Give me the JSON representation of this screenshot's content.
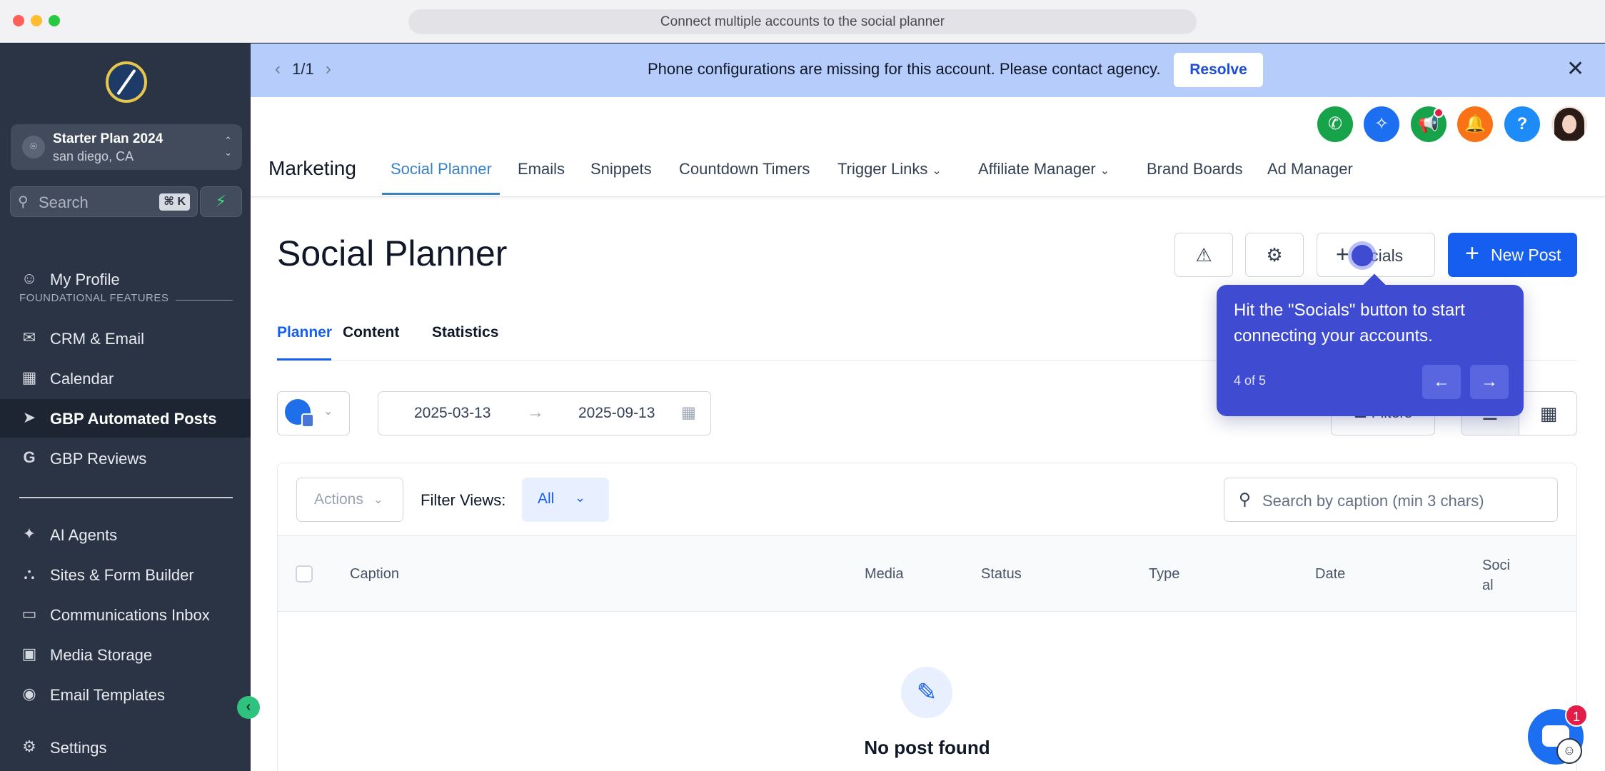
{
  "window": {
    "title": "Connect multiple accounts to the social planner"
  },
  "sidebar": {
    "account": {
      "name": "Starter Plan 2024",
      "location": "san diego, CA"
    },
    "search": {
      "placeholder": "Search",
      "shortcut": "⌘ K"
    },
    "items": [
      {
        "label": "My Profile",
        "icon": "user-circle-icon"
      },
      {
        "label": "CRM & Email",
        "icon": "envelope-open-icon"
      },
      {
        "label": "Calendar",
        "icon": "calendar-icon"
      },
      {
        "label": "GBP Automated Posts",
        "icon": "navigation-arrow-icon",
        "active": true
      },
      {
        "label": "GBP Reviews",
        "icon": "google-g-icon"
      },
      {
        "label": "AI Agents",
        "icon": "sparkles-icon"
      },
      {
        "label": "Sites & Form Builder",
        "icon": "sitemap-icon"
      },
      {
        "label": "Communications Inbox",
        "icon": "inbox-icon"
      },
      {
        "label": "Media Storage",
        "icon": "images-icon"
      },
      {
        "label": "Email Templates",
        "icon": "play-circle-icon"
      },
      {
        "label": "Settings",
        "icon": "gear-icon"
      }
    ],
    "section_label": "FOUNDATIONAL FEATURES"
  },
  "banner": {
    "pager": "1/1",
    "message": "Phone configurations are missing for this account. Please contact agency.",
    "resolve_label": "Resolve",
    "color": "#b6cdfc"
  },
  "header_icons": [
    {
      "name": "phone-icon",
      "color": "#16a34a"
    },
    {
      "name": "sparkle-icon",
      "color": "#1d6ff2"
    },
    {
      "name": "megaphone-icon",
      "color": "#16a34a"
    },
    {
      "name": "bell-icon",
      "color": "#f97316"
    },
    {
      "name": "help-icon",
      "color": "#1d8cf8"
    }
  ],
  "topnav": {
    "title": "Marketing",
    "items": [
      {
        "label": "Social Planner",
        "active": true
      },
      {
        "label": "Emails"
      },
      {
        "label": "Snippets"
      },
      {
        "label": "Countdown Timers"
      },
      {
        "label": "Trigger Links",
        "dropdown": true
      },
      {
        "label": "Affiliate Manager",
        "dropdown": true
      },
      {
        "label": "Brand Boards"
      },
      {
        "label": "Ad Manager"
      }
    ]
  },
  "page": {
    "title": "Social Planner",
    "socials_label": "Socials",
    "socials_visible_label": "cials",
    "new_post_label": "New Post",
    "tabs": [
      "Planner",
      "Content",
      "Statistics"
    ],
    "date_from": "2025-03-13",
    "date_to": "2025-09-13",
    "filters_label": "Filters"
  },
  "table": {
    "actions_label": "Actions",
    "filter_views_label": "Filter Views:",
    "filter_view_value": "All",
    "search_placeholder": "Search by caption (min 3 chars)",
    "columns": [
      "Caption",
      "Media",
      "Status",
      "Type",
      "Date",
      "Soci al"
    ],
    "empty_text": "No post found"
  },
  "tooltip": {
    "text": "Hit the \"Socials\" button to start connecting your accounts.",
    "step": "4 of 5"
  },
  "chat": {
    "badge_count": "1"
  },
  "colors": {
    "primary": "#155eef",
    "sidebar_bg": "#2b3444",
    "tooltip_bg": "#3f4bd1"
  }
}
